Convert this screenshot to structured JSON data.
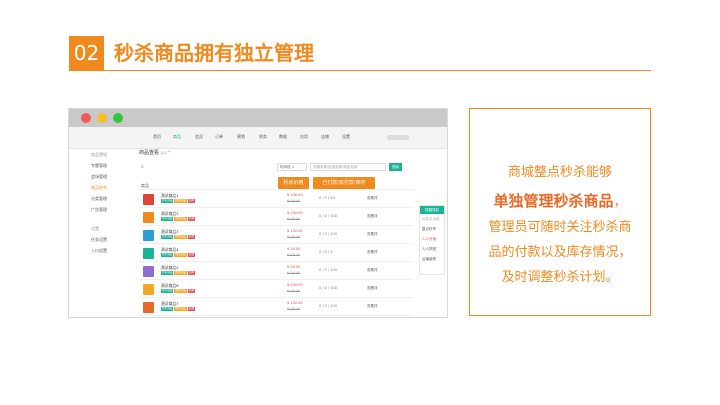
{
  "slide": {
    "number": "02",
    "title": "秒杀商品拥有独立管理"
  },
  "app": {
    "nav": [
      "首页",
      "商品",
      "会员",
      "订单",
      "营销",
      "财务",
      "数据",
      "应用",
      "店铺",
      "设置"
    ],
    "nav_active_index": 1,
    "sidebar": [
      {
        "label": "商品营销",
        "kind": "group"
      },
      {
        "label": "专题管理",
        "kind": "item"
      },
      {
        "label": "会场管理",
        "kind": "item"
      },
      {
        "label": "商品秒杀",
        "kind": "active"
      },
      {
        "label": "分类管理",
        "kind": "item"
      },
      {
        "label": "广告管理",
        "kind": "item"
      },
      {
        "label": "设置",
        "kind": "group"
      },
      {
        "label": "任务设置",
        "kind": "item"
      },
      {
        "label": "入口设置",
        "kind": "item"
      }
    ],
    "main_title": "商品查看",
    "main_title_sub": "名称",
    "main_title_mark": "*",
    "time_select": "时间段",
    "time_select_caret": "⇕",
    "search_placeholder": "关键名称/全选名称/商品名称",
    "search_button": "搜索",
    "callout_a": "秒杀价格",
    "callout_b": "已付款/未付款/库存",
    "col_header": "商品",
    "rows": [
      {
        "name": "测试商品1",
        "tags": [
          "秒杀商品",
          "爆款商品",
          "包邮"
        ],
        "price": "¥ 100.00",
        "original": "¥100.00",
        "stock": "0 / 0 / 10",
        "op": "查看详"
      },
      {
        "name": "测试商品2",
        "tags": [
          "秒杀商品",
          "爆款商品",
          "包邮"
        ],
        "price": "¥ 100.00",
        "original": "¥100.00",
        "stock": "0 / 0 / 100",
        "op": "查看详"
      },
      {
        "name": "测试商品3",
        "tags": [
          "秒杀商品",
          "爆款商品",
          "包邮"
        ],
        "price": "¥ 100.00",
        "original": "¥100.00",
        "stock": "0 / 0 / 100",
        "op": "查看详"
      },
      {
        "name": "测试商品4",
        "tags": [
          "秒杀商品",
          "爆款商品",
          "包邮"
        ],
        "price": "¥ 50.00",
        "original": "¥100.00",
        "stock": "0 / 0 / 0",
        "op": "查看详"
      },
      {
        "name": "测试商品5",
        "tags": [
          "秒杀商品",
          "爆款商品",
          "包邮"
        ],
        "price": "¥ 50.00",
        "original": "¥100.00",
        "stock": "0 / 0 / 100",
        "op": "查看详"
      },
      {
        "name": "测试商品6",
        "tags": [
          "秒杀商品",
          "爆款商品",
          "包邮"
        ],
        "price": "¥ 100.00",
        "original": "¥100.00",
        "stock": "0 / 0 / 100",
        "op": "查看详"
      },
      {
        "name": "测试商品7",
        "tags": [
          "秒杀商品",
          "爆款商品",
          "包邮"
        ],
        "price": "¥ 100.00",
        "original": "¥100.00",
        "stock": "0 / 0 / 100",
        "op": "查看详"
      }
    ],
    "thumb_colors": [
      "#e0433a",
      "#f18a1e",
      "#2d9cdb",
      "#1ab394",
      "#8e6fd1",
      "#f5a623",
      "#e86a26"
    ],
    "quicknav": {
      "title": "快捷导航",
      "items": [
        {
          "label": "可新平台链",
          "kind": "muted"
        },
        {
          "label": "整点秒杀",
          "kind": "item"
        },
        {
          "label": "人人分销",
          "kind": "red"
        },
        {
          "label": "人人拼团",
          "kind": "item"
        },
        {
          "label": "店铺装修",
          "kind": "item"
        }
      ]
    }
  },
  "description": {
    "line1": "商城整点秒杀能够",
    "line2": "单独管理秒杀商品",
    "line2_comma": "，",
    "line3": "管理员可随时关注秒杀商",
    "line4": "品的付款以及库存情况，",
    "line5": "及时调整秒杀计划。"
  },
  "colors": {
    "accent": "#f18a1e",
    "accent_dark": "#e86a26",
    "app_green": "#1ab394"
  }
}
